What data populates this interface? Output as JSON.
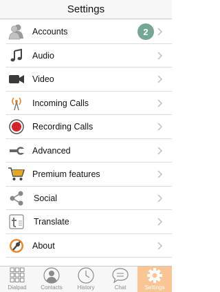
{
  "header": {
    "title": "Settings"
  },
  "settings": {
    "items": [
      {
        "label": "Accounts",
        "icon": "accounts-icon",
        "badge": "2"
      },
      {
        "label": "Audio",
        "icon": "music-note-icon"
      },
      {
        "label": "Video",
        "icon": "video-camera-icon"
      },
      {
        "label": "Incoming Calls",
        "icon": "antenna-icon"
      },
      {
        "label": "Recording Calls",
        "icon": "record-icon"
      },
      {
        "label": "Advanced",
        "icon": "wrench-icon"
      },
      {
        "label": "Premium features",
        "icon": "shopping-cart-icon"
      },
      {
        "label": "Social",
        "icon": "share-icon"
      },
      {
        "label": "Translate",
        "icon": "translate-icon"
      },
      {
        "label": "About",
        "icon": "about-icon"
      }
    ]
  },
  "tabbar": {
    "tabs": [
      {
        "label": "Dialpad",
        "icon": "dialpad-icon"
      },
      {
        "label": "Contacts",
        "icon": "contacts-icon"
      },
      {
        "label": "History",
        "icon": "clock-icon"
      },
      {
        "label": "Chat",
        "icon": "chat-bubble-icon"
      },
      {
        "label": "Settings",
        "icon": "gear-icon",
        "active": true
      }
    ]
  },
  "colors": {
    "badge": "#74a893",
    "active_tab": "#f9c593",
    "record": "#d9232a",
    "antenna": "#e8892b",
    "cart": "#e6a817"
  }
}
